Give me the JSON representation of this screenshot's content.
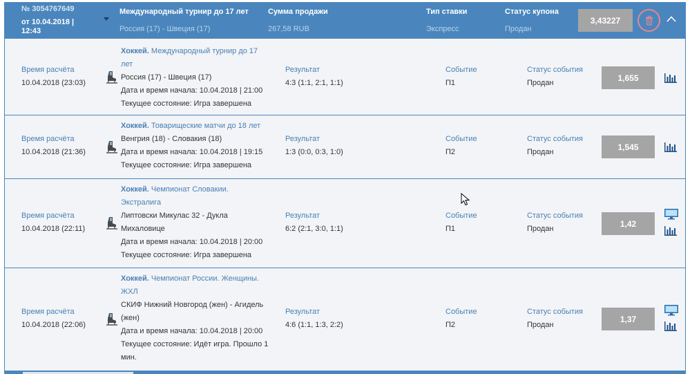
{
  "coupon": {
    "number": "№ 3054767649",
    "date": "от 10.04.2018 |",
    "time": "12:43",
    "event_title": "Международный турнир до 17 лет",
    "event_sub": "Россия (17) - Швеция (17)",
    "sum_label": "Сумма продажи",
    "sum_value": "267,58 RUB",
    "type_label": "Тип ставки",
    "type_value": "Экспресс",
    "status_label": "Статус купона",
    "status_value": "Продан",
    "total_odds": "3,43227",
    "colors": {
      "header_bg": "#4a86bd",
      "odds_bg": "#a5a5a5",
      "delete_ring": "#e7868f",
      "row_bg": "#f2f4f7",
      "link": "#4a7fb5"
    },
    "icons": {
      "delete": "trash-icon",
      "collapse": "chevron-up-icon",
      "expand": "caret-down-icon"
    }
  },
  "rows": [
    {
      "calc_label": "Время расчёта",
      "calc_value": "10.04.2018 (23:03)",
      "sport": "Хоккей.",
      "tournament_1": "Международный турнир до 17",
      "tournament_2": "лет",
      "teams_1": "Россия (17) - Швеция (17)",
      "start": "Дата и время начала: 10.04.2018 | 21:00",
      "state_1": "Текущее состояние: Игра завершена",
      "result_label": "Результат",
      "result_value": "4:3 (1:1, 2:1, 1:1)",
      "event_label": "Событие",
      "event_value": "П1",
      "status_label": "Статус события",
      "status_value": "Продан",
      "odds": "1,655"
    },
    {
      "calc_label": "Время расчёта",
      "calc_value": "10.04.2018 (21:36)",
      "sport": "Хоккей.",
      "tournament_1": "Товарищеские матчи до 18 лет",
      "teams_1": "Венгрия (18) - Словакия (18)",
      "start": "Дата и время начала: 10.04.2018 | 19:15",
      "state_1": "Текущее состояние: Игра завершена",
      "result_label": "Результат",
      "result_value": "1:3 (0:0, 0:3, 1:0)",
      "event_label": "Событие",
      "event_value": "П2",
      "status_label": "Статус события",
      "status_value": "Продан",
      "odds": "1,545"
    },
    {
      "calc_label": "Время расчёта",
      "calc_value": "10.04.2018 (22:11)",
      "sport": "Хоккей.",
      "tournament_1": "Чемпионат Словакии.",
      "tournament_2": "Экстралига",
      "teams_1": "Липтовски Микулас 32 - Дукла",
      "teams_2": "Михаловице",
      "start": "Дата и время начала: 10.04.2018 | 20:00",
      "state_1": "Текущее состояние: Игра завершена",
      "result_label": "Результат",
      "result_value": "6:2 (2:1, 3:0, 1:1)",
      "event_label": "Событие",
      "event_value": "П1",
      "status_label": "Статус события",
      "status_value": "Продан",
      "odds": "1,42"
    },
    {
      "calc_label": "Время расчёта",
      "calc_value": "10.04.2018 (22:06)",
      "sport": "Хоккей.",
      "tournament_1": "Чемпионат России. Женщины.",
      "tournament_2": "ЖХЛ",
      "teams_1": "СКИФ Нижний Новгород (жен) - Агидель",
      "teams_2": "(жен)",
      "start": "Дата и время начала: 10.04.2018 | 20:00",
      "state_1": "Текущее состояние: Идёт игра. Прошло 1",
      "state_2": "мин.",
      "result_label": "Результат",
      "result_value": "4:6 (1:1, 1:3, 2:2)",
      "event_label": "Событие",
      "event_value": "П2",
      "status_label": "Статус события",
      "status_value": "Продан",
      "odds": "1,37"
    }
  ]
}
